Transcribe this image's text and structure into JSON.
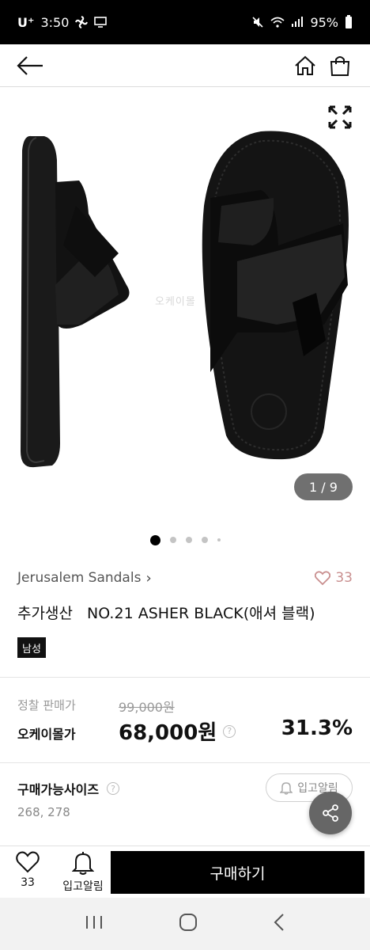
{
  "status_bar": {
    "carrier": "U⁺",
    "time": "3:50",
    "battery": "95%"
  },
  "gallery": {
    "counter": "1 / 9",
    "watermark": "오케이몰",
    "dot_count": 5,
    "active_index": 0
  },
  "product": {
    "brand": "Jerusalem Sandals",
    "brand_chevron": "›",
    "like_count": "33",
    "title": "추가생산   NO.21 ASHER BLACK(애셔 블랙)",
    "badge": "남성"
  },
  "price": {
    "regular_label": "정찰 판매가",
    "regular_price": "99,000원",
    "sale_label": "오케이몰가",
    "sale_price": "68,000원",
    "help": "?",
    "discount": "31.3%"
  },
  "sizes": {
    "title": "구매가능사이즈",
    "help": "?",
    "values": "268, 278",
    "restock_button": "입고알림"
  },
  "bottom_bar": {
    "like_count": "33",
    "alert_label": "입고알림",
    "buy_label": "구매하기"
  },
  "icons": [
    "back-arrow-icon",
    "home-icon",
    "shopping-bag-icon",
    "expand-icon",
    "heart-icon",
    "bell-icon",
    "share-icon",
    "recent-apps-icon",
    "home-circle-icon",
    "back-chevron-icon"
  ]
}
